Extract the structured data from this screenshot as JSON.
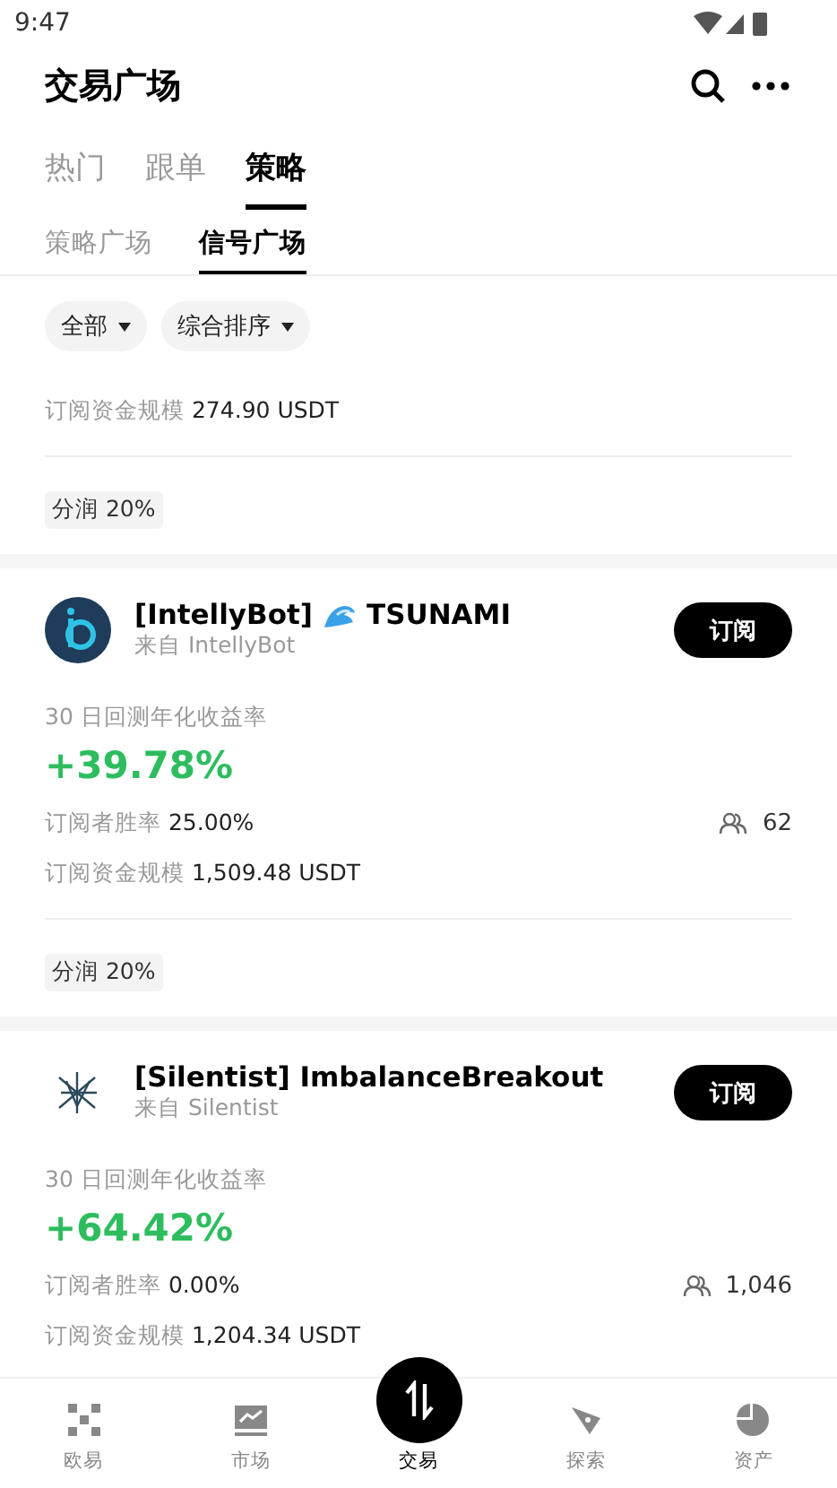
{
  "status_bar": {
    "time": "9:47"
  },
  "header": {
    "title": "交易广场"
  },
  "tabs": [
    {
      "label": "热门",
      "selected": false
    },
    {
      "label": "跟单",
      "selected": false
    },
    {
      "label": "策略",
      "selected": true
    }
  ],
  "sub_tabs": [
    {
      "label": "策略广场",
      "selected": false
    },
    {
      "label": "信号广场",
      "selected": true
    }
  ],
  "filters": [
    {
      "label": "全部"
    },
    {
      "label": "综合排序"
    }
  ],
  "cards": [
    {
      "kind": "partial",
      "fund_label": "订阅资金规模",
      "fund_value": "274.90 USDT",
      "tag": "分润 20%"
    },
    {
      "kind": "full",
      "title_prefix": "[IntellyBot]",
      "title_suffix": "TSUNAMI",
      "source": "来自 IntellyBot",
      "button": "订阅",
      "return_label": "30 日回测年化收益率",
      "return_value": "+39.78%",
      "win_label": "订阅者胜率",
      "win_value": "25.00%",
      "subscribers": "62",
      "fund_label": "订阅资金规模",
      "fund_value": "1,509.48 USDT",
      "tag": "分润 20%"
    },
    {
      "kind": "full",
      "title_prefix": "[Silentist] ImbalanceBreakout",
      "source": "来自 Silentist",
      "button": "订阅",
      "return_label": "30 日回测年化收益率",
      "return_value": "+64.42%",
      "win_label": "订阅者胜率",
      "win_value": "0.00%",
      "subscribers": "1,046",
      "fund_label": "订阅资金规模",
      "fund_value": "1,204.34 USDT"
    }
  ],
  "bottom_nav": [
    {
      "label": "欧易",
      "selected": false
    },
    {
      "label": "市场",
      "selected": false
    },
    {
      "label": "交易",
      "selected": true
    },
    {
      "label": "探索",
      "selected": false
    },
    {
      "label": "资产",
      "selected": false
    }
  ]
}
